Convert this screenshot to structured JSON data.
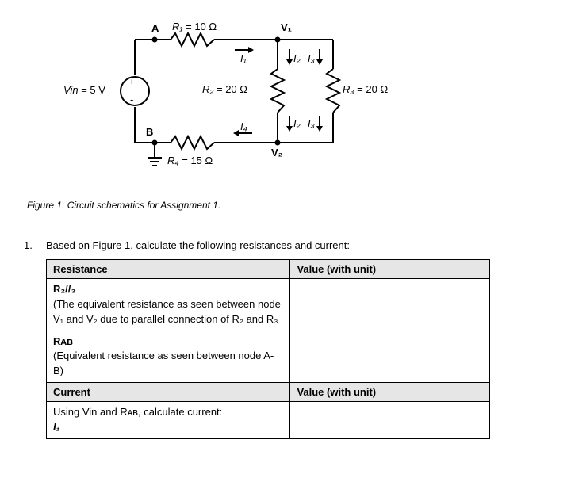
{
  "circuit": {
    "nodes": {
      "A": "A",
      "B": "B",
      "V1": "V₁",
      "V2": "V₂"
    },
    "source": {
      "label": "Vin",
      "value": "= 5 V",
      "plus": "+",
      "minus": "-"
    },
    "R1": {
      "name": "R₁",
      "val": "= 10 Ω"
    },
    "R2": {
      "name": "R₂",
      "val": "= 20 Ω"
    },
    "R3": {
      "name": "R₃",
      "val": "= 20 Ω"
    },
    "R4": {
      "name": "R₄",
      "val": "= 15 Ω"
    },
    "currents": {
      "I1": "I₁",
      "I2": "I₂",
      "I3": "I₃",
      "I4": "I₄"
    }
  },
  "caption": "Figure 1. Circuit schematics for Assignment 1.",
  "question": {
    "num": "1.",
    "prompt": "Based on Figure 1, calculate the following resistances and current:",
    "headers": {
      "res": "Resistance",
      "val": "Value (with unit)",
      "cur": "Current"
    },
    "rows": {
      "r23_name": "R₂//₃",
      "r23_desc": "(The equivalent resistance as seen between node V₁ and V₂ due to parallel connection of R₂ and R₃",
      "rab_name": "Rᴀʙ",
      "rab_desc": "(Equivalent resistance as seen between node A-B)",
      "cur_desc_a": "Using Vin and Rᴀʙ, calculate current:",
      "cur_desc_b": "I₁"
    },
    "blanks": {
      "r23": "",
      "rab": "",
      "i1": ""
    }
  },
  "chart_data": {
    "type": "circuit",
    "Vin_V": 5,
    "R1_ohm": 10,
    "R2_ohm": 20,
    "R3_ohm": 20,
    "R4_ohm": 15,
    "topology": "Vin in series with R1 to node V1; R2 and R3 in parallel from V1 to V2; R4 from V2 back through node B to Vin-; ground at B",
    "requested": [
      "R2||R3",
      "R_AB",
      "I1"
    ]
  }
}
